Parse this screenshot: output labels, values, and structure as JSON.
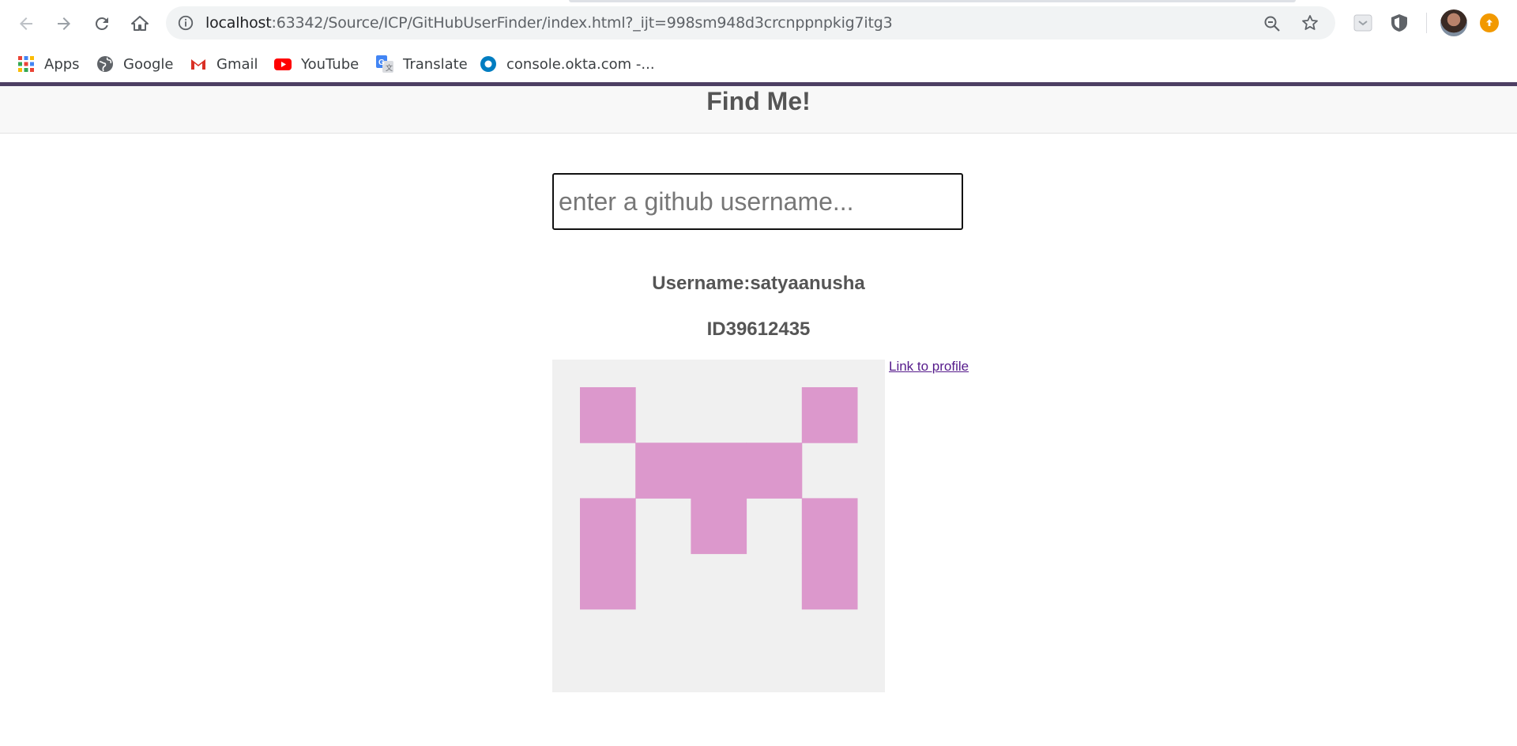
{
  "browser": {
    "url_host": "localhost",
    "url_rest": ":63342/Source/ICP/GitHubUserFinder/index.html?_ijt=998sm948d3crcnppnpkig7itg3",
    "bookmarks": [
      {
        "label": "Apps",
        "icon": "apps-grid-icon"
      },
      {
        "label": "Google",
        "icon": "globe-icon"
      },
      {
        "label": "Gmail",
        "icon": "gmail-icon"
      },
      {
        "label": "YouTube",
        "icon": "youtube-icon"
      },
      {
        "label": "Translate",
        "icon": "translate-icon"
      },
      {
        "label": "console.okta.com -...",
        "icon": "okta-icon"
      }
    ],
    "colors": {
      "accent_border": "#4d3f63",
      "update_badge": "#f29900"
    }
  },
  "page": {
    "title": "Find Me!",
    "search": {
      "placeholder": "enter a github username...",
      "value": ""
    },
    "username_text": "Username:satyaanusha",
    "id_text": "ID39612435",
    "profile_link_label": "Link to profile",
    "identicon": {
      "color": "#dc98cc",
      "background": "#f0f0f0",
      "grid": [
        [
          1,
          0,
          0,
          0,
          1
        ],
        [
          0,
          1,
          1,
          1,
          0
        ],
        [
          1,
          0,
          1,
          0,
          1
        ],
        [
          1,
          0,
          0,
          0,
          1
        ]
      ]
    }
  }
}
